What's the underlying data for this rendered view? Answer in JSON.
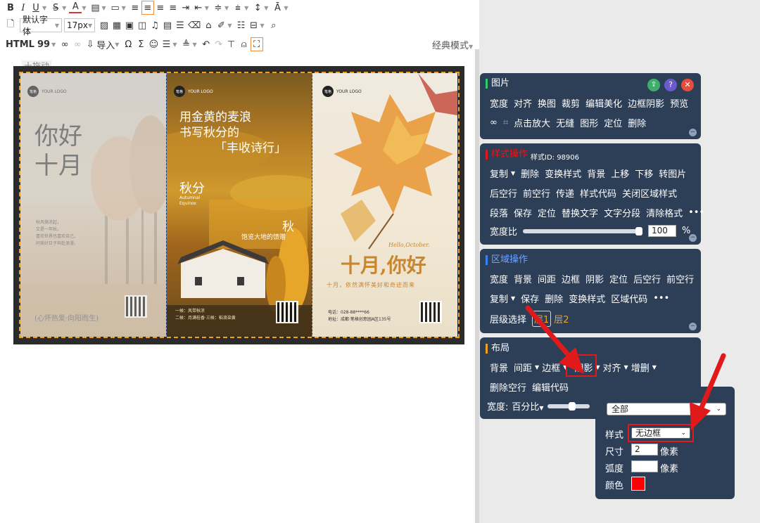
{
  "toolbar": {
    "font_name": "默认字体",
    "font_size": "17px",
    "html_label": "HTML",
    "import_label": "导入",
    "mode_label": "经典模式"
  },
  "editor": {
    "drag_label": "十拖动"
  },
  "posters": {
    "p1": {
      "logo_circle": "笔格\n设计",
      "logo_text": "YOUR LOGO",
      "big_line1": "你好",
      "big_line2": "十月",
      "poem": [
        "秋风微凉起，",
        "又是一年秋。",
        "喜欢世界也喜欢自己，",
        "同美好日子奔赴浪漫。"
      ],
      "footer": "(心怀热爱·向阳而生)"
    },
    "p2": {
      "logo_circle": "笔格\n设计",
      "logo_text": "YOUR LOGO",
      "headline1": "用金黄的麦浪",
      "headline2": "书写秋分的",
      "headline3": "「丰收诗行」",
      "season": "秋分",
      "season_en1": "Autumnal",
      "season_en2": "Equinox",
      "qiu": "秋",
      "sub": "饱览大地的馈赠",
      "info1": "一候：风带秋凉",
      "info2": "二候：月满桂香·三候：稻浪染黄"
    },
    "p3": {
      "logo_circle": "笔格\n设计",
      "logo_text": "YOUR LOGO",
      "hello": "Hello,October.",
      "title": "十月,你好",
      "slogan": "十月，依然满怀美好和奇迹而来",
      "tel": "电话：028-88****66",
      "addr": "地址：成都·笔格创意园A区135号"
    }
  },
  "image_panel": {
    "title": "图片",
    "row1": [
      "宽度",
      "对齐",
      "换图",
      "裁剪",
      "编辑美化",
      "边框阴影",
      "预览"
    ],
    "row2": [
      "点击放大",
      "无缝",
      "图形",
      "定位",
      "删除"
    ]
  },
  "style_panel": {
    "title": "样式操作",
    "style_id": "样式ID: 98906",
    "row1": [
      "复制",
      "删除",
      "变换样式",
      "背景",
      "上移",
      "下移",
      "转图片"
    ],
    "row2": [
      "后空行",
      "前空行",
      "传递",
      "样式代码",
      "关闭区域样式"
    ],
    "row3": [
      "段落",
      "保存",
      "定位",
      "替换文字",
      "文字分段",
      "清除格式"
    ],
    "width_label": "宽度比",
    "width_value": "100",
    "width_unit": "%",
    "width_ratio": 1.0
  },
  "region_panel": {
    "title": "区域操作",
    "row1": [
      "宽度",
      "背景",
      "间距",
      "边框",
      "阴影",
      "定位",
      "后空行",
      "前空行"
    ],
    "row2": [
      "复制",
      "保存",
      "删除",
      "变换样式",
      "区域代码"
    ],
    "layer_label": "层级选择",
    "layer1": "层1",
    "layer2": "层2"
  },
  "layout_panel": {
    "title": "布局",
    "items": [
      "背景",
      "间距",
      "边框",
      "阴影",
      "对齐",
      "增删"
    ],
    "row2": [
      "删除空行",
      "编辑代码"
    ],
    "width_label": "宽度:",
    "width_mode": "百分比"
  },
  "border_popup": {
    "scope": "全部",
    "style_label": "样式",
    "style_value": "无边框",
    "size_label": "尺寸",
    "size_value": "2",
    "size_unit": "像素",
    "radius_label": "弧度",
    "radius_value": "",
    "radius_unit": "像素",
    "color_label": "颜色",
    "color_value": "#ff0000"
  },
  "colors": {
    "panel_bg": "#2d3e57",
    "accent_green": "#2ecc71",
    "accent_red": "#e0191b",
    "layer_orange": "#f0a020"
  }
}
